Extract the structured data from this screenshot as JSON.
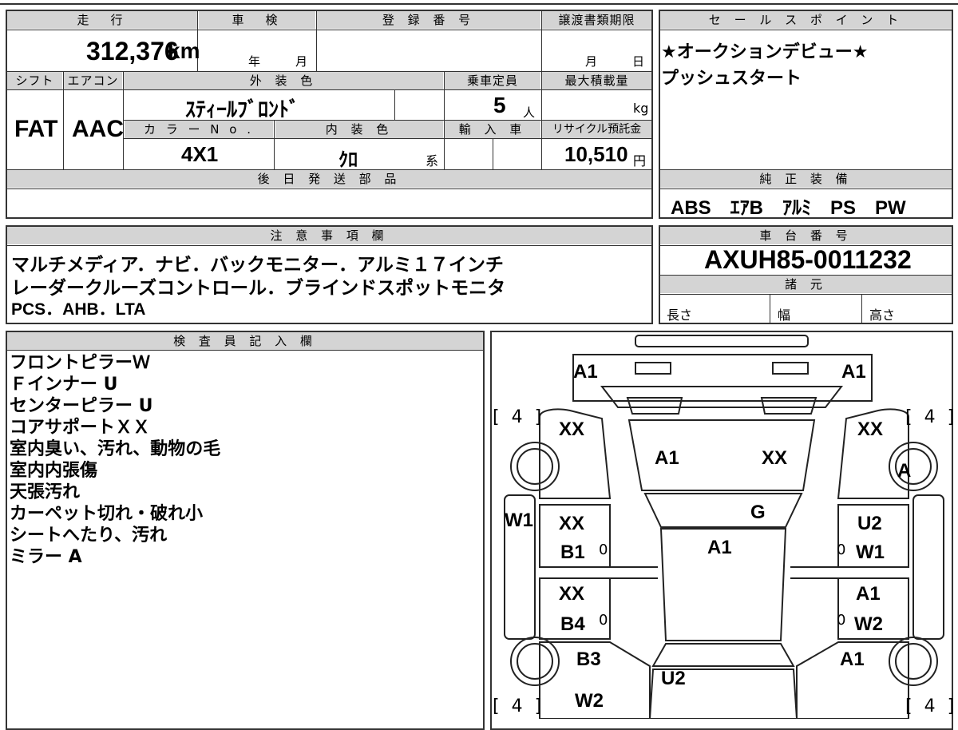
{
  "headers": {
    "mileage": "走　行",
    "shaken": "車　検",
    "registration": "登 録 番 号",
    "transfer_deadline": "譲渡書類期限",
    "sales_point": "セ ー ル ス ポ イ ン ト",
    "shift": "シフト",
    "ac": "エアコン",
    "exterior_color": "外 装 色",
    "capacity": "乗車定員",
    "max_load": "最大積載量",
    "color_no": "カ ラ ー N o .",
    "interior_color": "内 装 色",
    "import": "輸 入 車",
    "recycle": "リサイクル預託金",
    "later_parts": "後 日 発 送 部 品",
    "genuine_equipment": "純 正 装 備",
    "notes": "注 意 事 項 欄",
    "chassis_no": "車 台 番 号",
    "specs": "諸 元",
    "inspector": "検 査 員 記 入 欄"
  },
  "vehicle": {
    "mileage": "312,376",
    "mileage_unit": "km",
    "shaken_year_unit": "年",
    "shaken_month_unit": "月",
    "deadline_month_unit": "月",
    "deadline_day_unit": "日",
    "shift": "FAT",
    "ac": "AAC",
    "exterior_color": "ｽﾃｨｰﾙﾌﾞﾛﾝﾄﾞ",
    "capacity": "5",
    "capacity_unit": "人",
    "load_unit": "kg",
    "color_no": "4X1",
    "interior_color": "ｸﾛ",
    "interior_suffix": "系",
    "recycle_fee": "10,510",
    "recycle_unit": "円",
    "chassis_no": "AXUH85-0011232",
    "spec_length": "長さ",
    "spec_width": "幅",
    "spec_height": "高さ"
  },
  "sales_points": [
    "★オークションデビュー★",
    "プッシュスタート"
  ],
  "equipment": "ABS　ｴｱB　ｱﾙﾐ　PS　PW",
  "notes": [
    "マルチメディア．ナビ．バックモニター．アルミ１７インチ",
    "レーダークルーズコントロール．ブラインドスポットモニタ",
    "PCS．AHB．LTA"
  ],
  "inspector_remarks": [
    "フロントピラーＷ",
    "Ｆインナー U",
    "センターピラー U",
    "コアサポートＸＸ",
    "室内臭い、汚れ、動物の毛",
    "室内内張傷",
    "天張汚れ",
    "カーペット切れ・破れ小",
    "シートへたり、汚れ",
    "ミラー A"
  ],
  "diagram": {
    "tyre_fl": "[ 4 ]",
    "tyre_fr": "[ 4 ]",
    "tyre_rl": "[ 4 ]",
    "tyre_rr": "[ 4 ]",
    "marks": {
      "front_left_a1": "A1",
      "front_right_a1": "A1",
      "fender_left": "XX",
      "fender_right": "XX",
      "hood_left": "A1",
      "hood_right": "XX",
      "wheel_front_right": "A",
      "windshield": "G",
      "pillar_left": "W1",
      "door_fl_top": "XX",
      "door_fl_bottom": "B1",
      "door_fr_top": "U2",
      "door_fr_bottom": "W1",
      "roof": "A1",
      "door_rl_top": "XX",
      "door_rl_bottom": "B4",
      "door_rr_top": "A1",
      "door_rr_bottom": "W2",
      "quarter_left": "B3",
      "quarter_right": "A1",
      "trunk": "U2",
      "rear_left": "W2",
      "small_0a": "0",
      "small_0b": "0",
      "small_0c": "0",
      "small_0d": "0"
    }
  }
}
